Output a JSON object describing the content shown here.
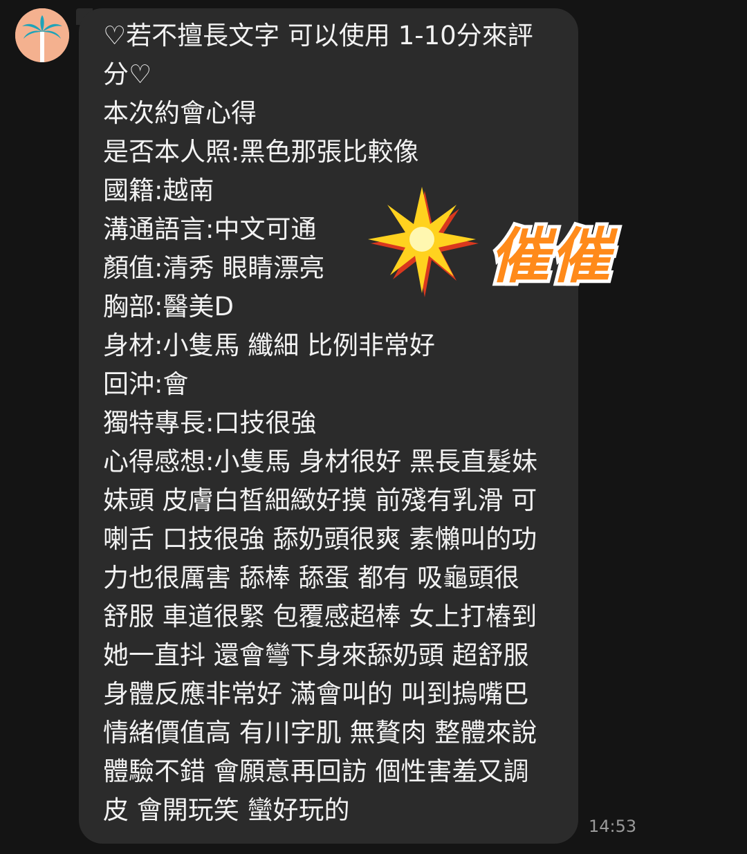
{
  "chat": {
    "sender_avatar": "palm-tree-icon",
    "message_lines": [
      "♡若不擅長文字 可以使用 1-10分來評",
      "分♡",
      "本次約會心得",
      "是否本人照:黑色那張比較像",
      "國籍:越南",
      "溝通語言:中文可通",
      "顏值:清秀 眼睛漂亮",
      "胸部:醫美D",
      "身材:小隻馬 纖細 比例非常好",
      "回沖:會",
      "獨特專長:口技很強",
      "心得感想:小隻馬 身材很好 黑長直髮妹",
      "妹頭 皮膚白皙細緻好摸 前殘有乳滑 可",
      "喇舌 口技很強 舔奶頭很爽 素懶叫的功",
      "力也很厲害 舔棒 舔蛋 都有 吸龜頭很",
      "舒服 車道很緊 包覆感超棒 女上打樁到",
      "她一直抖 還會彎下身來舔奶頭 超舒服",
      "身體反應非常好 滿會叫的 叫到摀嘴巴",
      "情緒價值高 有川字肌 無贅肉 整體來說",
      "體驗不錯 會願意再回訪 個性害羞又調",
      "皮 會開玩笑 蠻好玩的"
    ],
    "timestamp": "14:53",
    "sticker": {
      "text": "催催",
      "icon": "starburst-icon",
      "colors": {
        "text_fill": "#ff8a1a",
        "text_stroke": "#ffffff",
        "star": "#ffd21f"
      }
    }
  }
}
